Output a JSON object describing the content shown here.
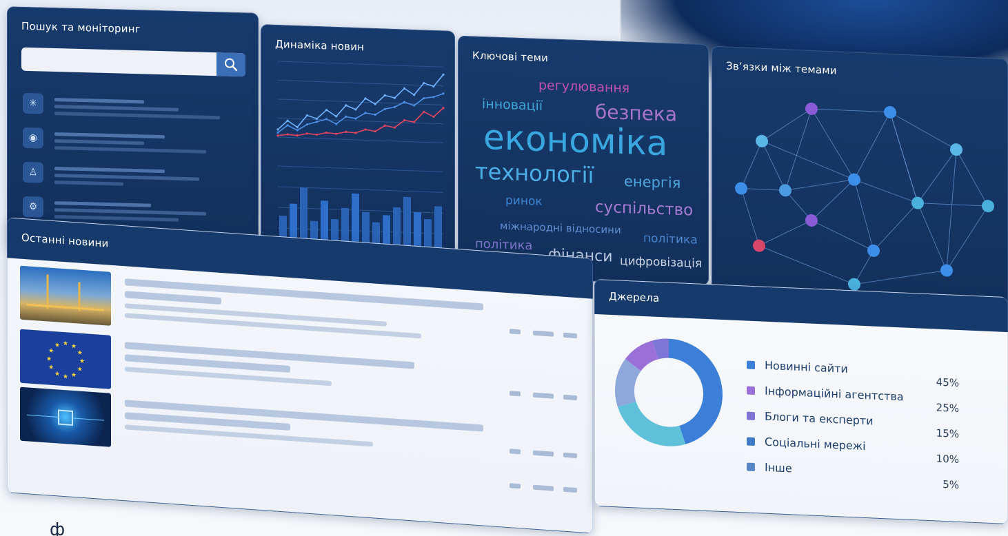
{
  "search": {
    "title": "Пошук та моніторинг",
    "placeholder": "",
    "icons": [
      "network-person-icon",
      "camera-shield-icon",
      "person-chart-icon",
      "analytics-icon"
    ]
  },
  "dynamics": {
    "title": "Динаміка новин"
  },
  "topics": {
    "title": "Ключові теми",
    "words": [
      {
        "text": "регулювання",
        "color": "#c14fb0"
      },
      {
        "text": "інновації",
        "color": "#3fa6d8"
      },
      {
        "text": "безпека",
        "color": "#a874c9"
      },
      {
        "text": "економіка",
        "color": "#3aa8e0"
      },
      {
        "text": "технології",
        "color": "#4cb0e6"
      },
      {
        "text": "енергія",
        "color": "#4ca6dc"
      },
      {
        "text": "ринок",
        "color": "#3c85d0"
      },
      {
        "text": "суспільство",
        "color": "#a57ad0"
      },
      {
        "text": "міжнародні відносини",
        "color": "#5f8fd1"
      },
      {
        "text": "політика",
        "color": "#7b75c9"
      },
      {
        "text": "політика",
        "color": "#4e86cf"
      },
      {
        "text": "фінанси",
        "color": "#b8c8e0"
      },
      {
        "text": "цифровізація",
        "color": "#c9d3e4"
      }
    ]
  },
  "network": {
    "title": "Зв’язки між темами"
  },
  "news": {
    "title": "Останні новини"
  },
  "sources": {
    "title": "Джерела",
    "items": [
      {
        "label": "Новинні сайти",
        "pct": "45%",
        "color": "#3b7fd9"
      },
      {
        "label": "Інформаційні агентства",
        "pct": "25%",
        "color": "#9a6fd8"
      },
      {
        "label": "Блоги та експерти",
        "pct": "15%",
        "color": "#7f75d6"
      },
      {
        "label": "Соціальні мережі",
        "pct": "10%",
        "color": "#3f7bc8"
      },
      {
        "label": "Інше",
        "pct": "5%",
        "color": "#5b86c6"
      }
    ]
  },
  "chart_data": [
    {
      "type": "line",
      "series": [
        {
          "values": [
            10,
            22,
            14,
            30,
            26,
            38,
            30,
            45,
            40,
            55,
            48,
            60,
            57,
            70,
            62,
            78,
            74,
            90
          ]
        },
        {
          "values": [
            6,
            16,
            10,
            18,
            22,
            26,
            20,
            30,
            28,
            36,
            34,
            42,
            45,
            52,
            48,
            58,
            60,
            65
          ]
        },
        {
          "values": [
            2,
            4,
            3,
            6,
            5,
            8,
            7,
            10,
            9,
            14,
            12,
            20,
            18,
            28,
            26,
            40,
            34,
            46
          ]
        }
      ]
    },
    {
      "type": "bar",
      "values": [
        40,
        55,
        75,
        35,
        60,
        38,
        52,
        70,
        48,
        36,
        45,
        55,
        68,
        50,
        42,
        58
      ]
    },
    {
      "type": "pie",
      "categories": [
        "Новинні сайти",
        "Інформаційні агентства",
        "Блоги та експерти",
        "Соціальні мережі",
        "Інше"
      ],
      "values": [
        45,
        25,
        15,
        10,
        5
      ]
    }
  ]
}
